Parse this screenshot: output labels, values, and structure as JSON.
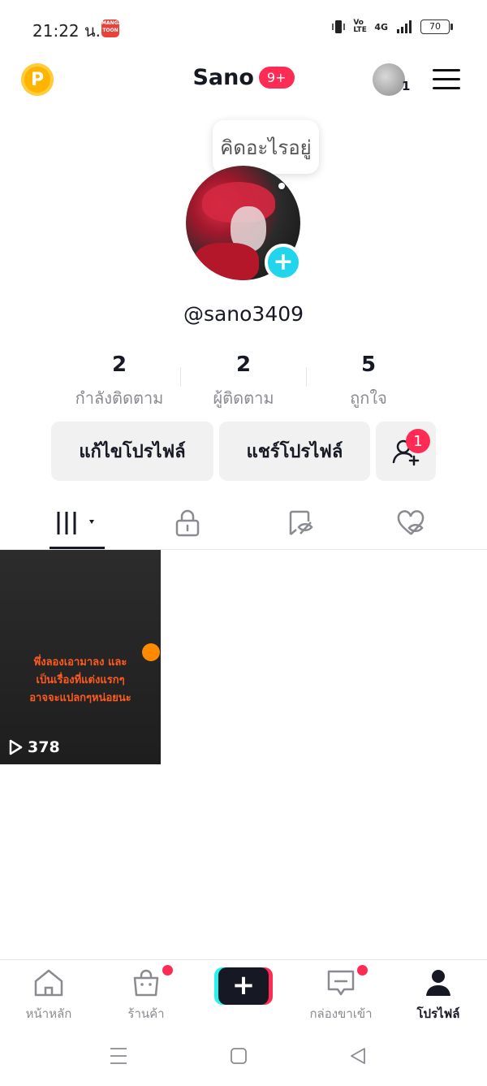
{
  "status_bar": {
    "time": "21:22 น.",
    "app_icon_text": "MANGA TOON",
    "network_1": "Vo LTE",
    "network_2": "4G",
    "battery": "70"
  },
  "header": {
    "coin_label": "P",
    "title": "Sano",
    "notification_badge": "9+",
    "account_count": "1"
  },
  "profile": {
    "status_bubble": "คิดอะไรอยู่",
    "add_avatar_symbol": "+",
    "username": "@sano3409",
    "stats": [
      {
        "value": "2",
        "label": "กำลังติดตาม"
      },
      {
        "value": "2",
        "label": "ผู้ติดตาม"
      },
      {
        "value": "5",
        "label": "ถูกใจ"
      }
    ],
    "buttons": {
      "edit_profile": "แก้ไขโปรไฟล์",
      "share_profile": "แชร์โปรไฟล์",
      "friend_badge": "1"
    }
  },
  "tabs": [
    {
      "name": "videos",
      "icon": "grid-icon",
      "active": true
    },
    {
      "name": "private",
      "icon": "lock-icon"
    },
    {
      "name": "reposts",
      "icon": "repost-icon"
    },
    {
      "name": "liked",
      "icon": "heart-hidden-icon"
    }
  ],
  "videos": [
    {
      "caption_lines": [
        "พึ่งลองเอามาลง และ",
        "เป็นเรื่องที่แต่งแรกๆ",
        "อาจจะแปลกๆหน่อยนะ"
      ],
      "views": "378"
    }
  ],
  "bottom_nav": [
    {
      "label": "หน้าหลัก",
      "icon": "home-icon"
    },
    {
      "label": "ร้านค้า",
      "icon": "shop-icon",
      "dot": true
    },
    {
      "label": "+",
      "icon": "create-icon"
    },
    {
      "label": "กล่องขาเข้า",
      "icon": "inbox-icon",
      "dot": true
    },
    {
      "label": "โปรไฟล์",
      "icon": "profile-icon",
      "active": true
    }
  ],
  "colors": {
    "accent": "#fe2c55",
    "cyan": "#20d5ec",
    "coin": "#ffb400"
  }
}
